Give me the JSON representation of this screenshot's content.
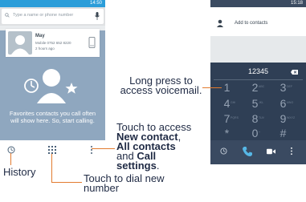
{
  "left_phone": {
    "status_time": "14:50",
    "search_placeholder": "Type a name or phone number",
    "favorite": {
      "name": "May",
      "number": "Mobile 0752 652 8220",
      "time": "2 hours ago"
    },
    "empty_message": "Favorites contacts you call often will show here. So, start calling."
  },
  "right_phone": {
    "status_time": "15:18",
    "add_to_contacts": "Add to contacts",
    "dialed_number": "12345",
    "keys": [
      {
        "digit": "1",
        "sub": ""
      },
      {
        "digit": "2",
        "sub": "ABC"
      },
      {
        "digit": "3",
        "sub": "DEF"
      },
      {
        "digit": "4",
        "sub": "GHI"
      },
      {
        "digit": "5",
        "sub": "JKL"
      },
      {
        "digit": "6",
        "sub": "MNO"
      },
      {
        "digit": "7",
        "sub": "PQRS"
      },
      {
        "digit": "8",
        "sub": "TUV"
      },
      {
        "digit": "9",
        "sub": "WXYZ"
      },
      {
        "digit": "*",
        "sub": ""
      },
      {
        "digit": "0",
        "sub": "+"
      },
      {
        "digit": "#",
        "sub": ""
      }
    ]
  },
  "annotations": {
    "history": "History",
    "dial_new_number_line1": "Touch to dial new",
    "dial_new_number_line2": "number",
    "menu_line1": "Touch to access",
    "menu_new_contact": "New contact",
    "menu_all_contacts": "All contacts",
    "menu_and": "and",
    "menu_call_settings_1": "Call",
    "menu_call_settings_2": "settings",
    "voicemail_line1": "Long press to",
    "voicemail_line2": "access voicemail."
  },
  "colors": {
    "status_bar_left": "#2b9dd9",
    "favorites_bg": "#8fa7bf",
    "dialer_bg": "#2f3f55",
    "callout_line": "#e27b2f",
    "call_button": "#56b7e6"
  }
}
